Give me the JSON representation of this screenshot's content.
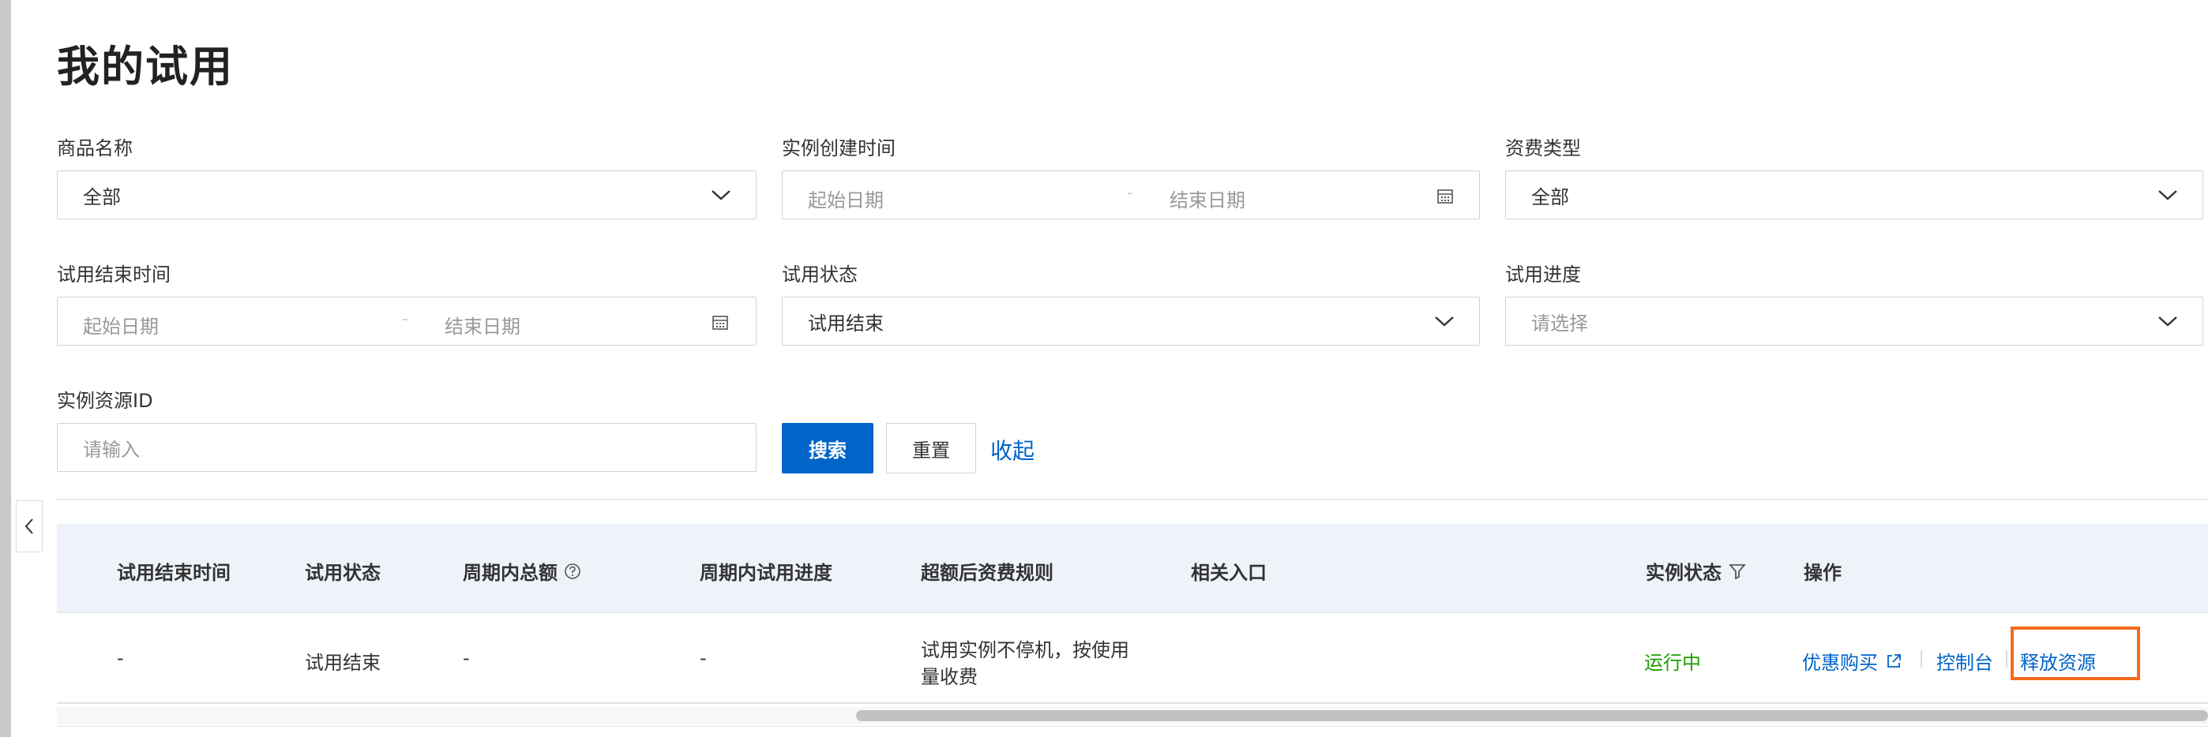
{
  "page": {
    "title": "我的试用"
  },
  "filters": {
    "product_name": {
      "label": "商品名称",
      "value": "全部"
    },
    "instance_created": {
      "label": "实例创建时间",
      "start_placeholder": "起始日期",
      "end_placeholder": "结束日期",
      "separator": "-"
    },
    "billing_type": {
      "label": "资费类型",
      "value": "全部"
    },
    "trial_end_time": {
      "label": "试用结束时间",
      "start_placeholder": "起始日期",
      "end_placeholder": "结束日期",
      "separator": "-"
    },
    "trial_status": {
      "label": "试用状态",
      "value": "试用结束"
    },
    "trial_progress": {
      "label": "试用进度",
      "placeholder": "请选择"
    },
    "instance_id": {
      "label": "实例资源ID",
      "placeholder": "请输入"
    }
  },
  "actions": {
    "search": "搜索",
    "reset": "重置",
    "collapse": "收起"
  },
  "table": {
    "headers": {
      "trial_end_time": "试用结束时间",
      "trial_status": "试用状态",
      "period_total": "周期内总额",
      "period_progress": "周期内试用进度",
      "over_billing": "超额后资费规则",
      "entry": "相关入口",
      "instance_status": "实例状态",
      "operation": "操作"
    },
    "rows": [
      {
        "trial_end_time": "-",
        "trial_status": "试用结束",
        "period_total": "-",
        "period_progress": "-",
        "over_billing_line1": "试用实例不停机，按使用",
        "over_billing_line2": "量收费",
        "instance_status": "运行中",
        "op_discount": "优惠购买",
        "op_console": "控制台",
        "op_release": "释放资源"
      }
    ]
  },
  "colors": {
    "primary": "#0064c8",
    "running": "#1e9e00",
    "highlight": "#f26b1d"
  }
}
